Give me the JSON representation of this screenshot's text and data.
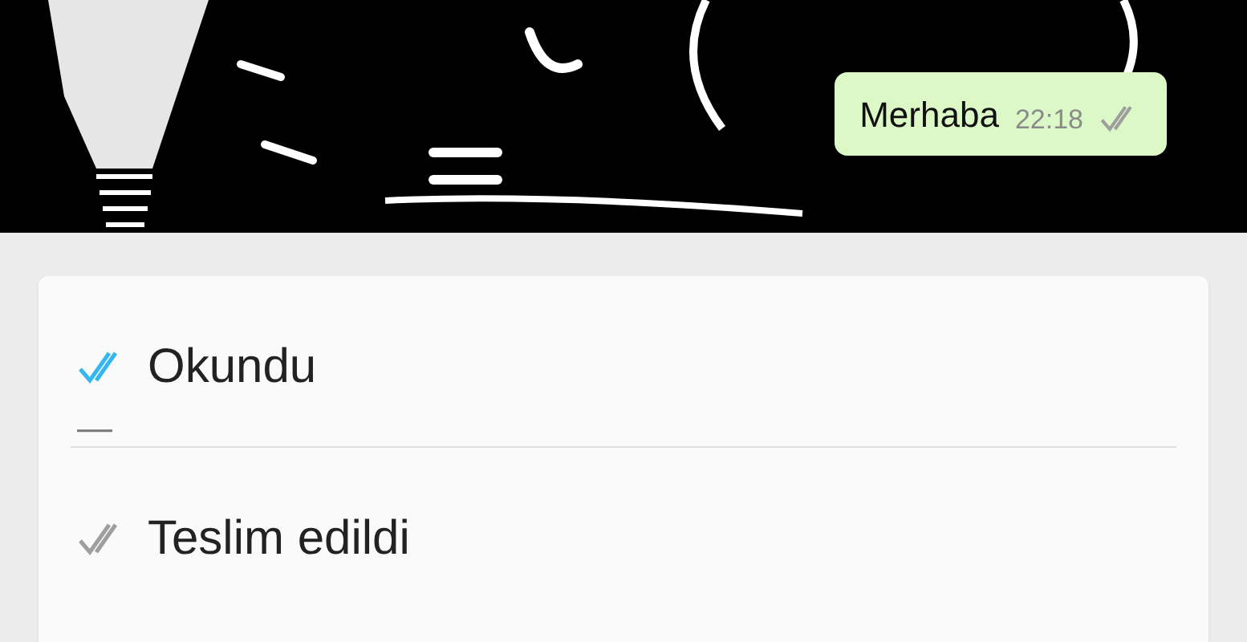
{
  "message": {
    "text": "Merhaba",
    "time": "22:18",
    "read": false
  },
  "statuses": [
    {
      "label": "Okundu",
      "read": true,
      "value": "—"
    },
    {
      "label": "Teslim edildi",
      "read": false
    }
  ]
}
